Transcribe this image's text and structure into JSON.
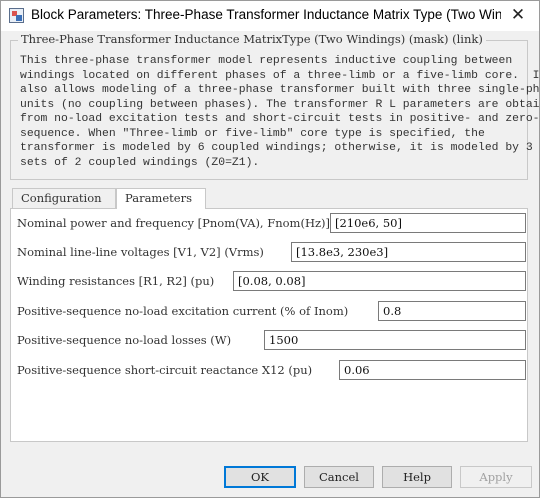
{
  "window": {
    "title": "Block Parameters: Three-Phase Transformer Inductance Matrix Type (Two Windi...",
    "close_glyph": "✕"
  },
  "mask": {
    "legend": "Three-Phase Transformer Inductance MatrixType (Two Windings) (mask) (link)",
    "description": "This three-phase transformer model represents inductive coupling between\nwindings located on different phases of a three-limb or a five-limb core.  It\nalso allows modeling of a three-phase transformer built with three single-phase\nunits (no coupling between phases). The transformer R L parameters are obtained\nfrom no-load excitation tests and short-circuit tests in positive- and zero-\nsequence. When \"Three-limb or five-limb\" core type is specified, the\ntransformer is modeled by 6 coupled windings; otherwise, it is modeled by 3\nsets of 2 coupled windings (Z0=Z1)."
  },
  "tabs": [
    {
      "label": "Configuration",
      "active": false
    },
    {
      "label": "Parameters",
      "active": true
    }
  ],
  "parameters": [
    {
      "label": "Nominal power and frequency [Pnom(VA), Fnom(Hz)]",
      "value": "[210e6, 50]"
    },
    {
      "label": "Nominal line-line voltages [V1, V2] (Vrms)",
      "value": "[13.8e3, 230e3]"
    },
    {
      "label": "Winding resistances [R1, R2] (pu)",
      "value": "[0.08, 0.08]"
    },
    {
      "label": "Positive-sequence no-load excitation current (% of Inom)",
      "value": "0.8"
    },
    {
      "label": "Positive-sequence no-load losses (W)",
      "value": "1500"
    },
    {
      "label": "Positive-sequence short-circuit reactance X12 (pu)",
      "value": "0.06"
    }
  ],
  "buttons": {
    "ok": "OK",
    "cancel": "Cancel",
    "help": "Help",
    "apply": "Apply"
  }
}
